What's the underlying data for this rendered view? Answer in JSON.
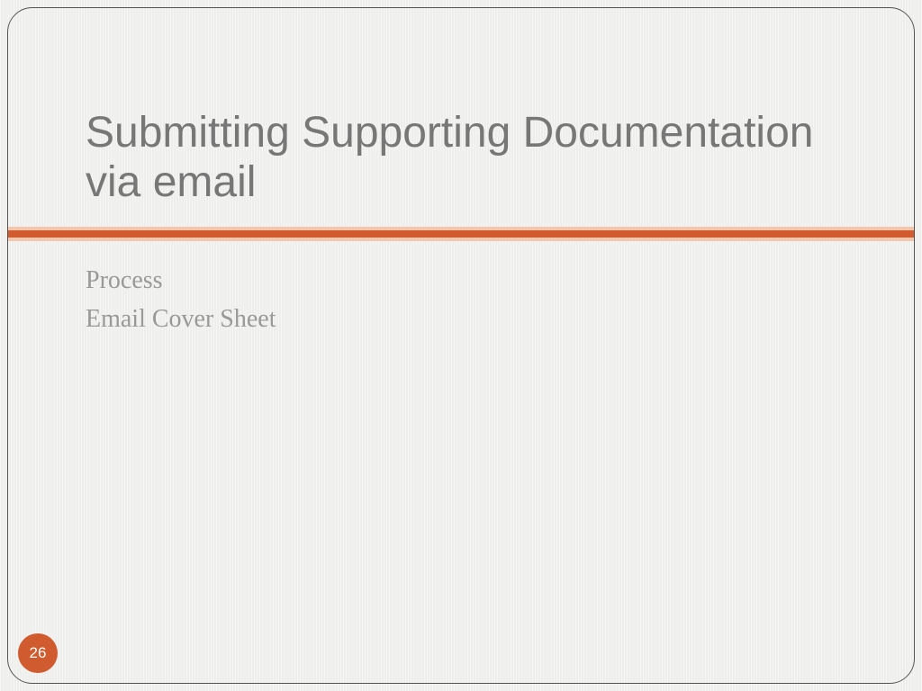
{
  "slide": {
    "title": "Submitting Supporting Documentation via email",
    "body_lines": [
      "Process",
      "Email Cover Sheet"
    ],
    "page_number": "26"
  },
  "colors": {
    "accent": "#cf5b2e",
    "accent_light": "#f3c6ae",
    "title_text": "#777777",
    "body_text": "#999999"
  }
}
